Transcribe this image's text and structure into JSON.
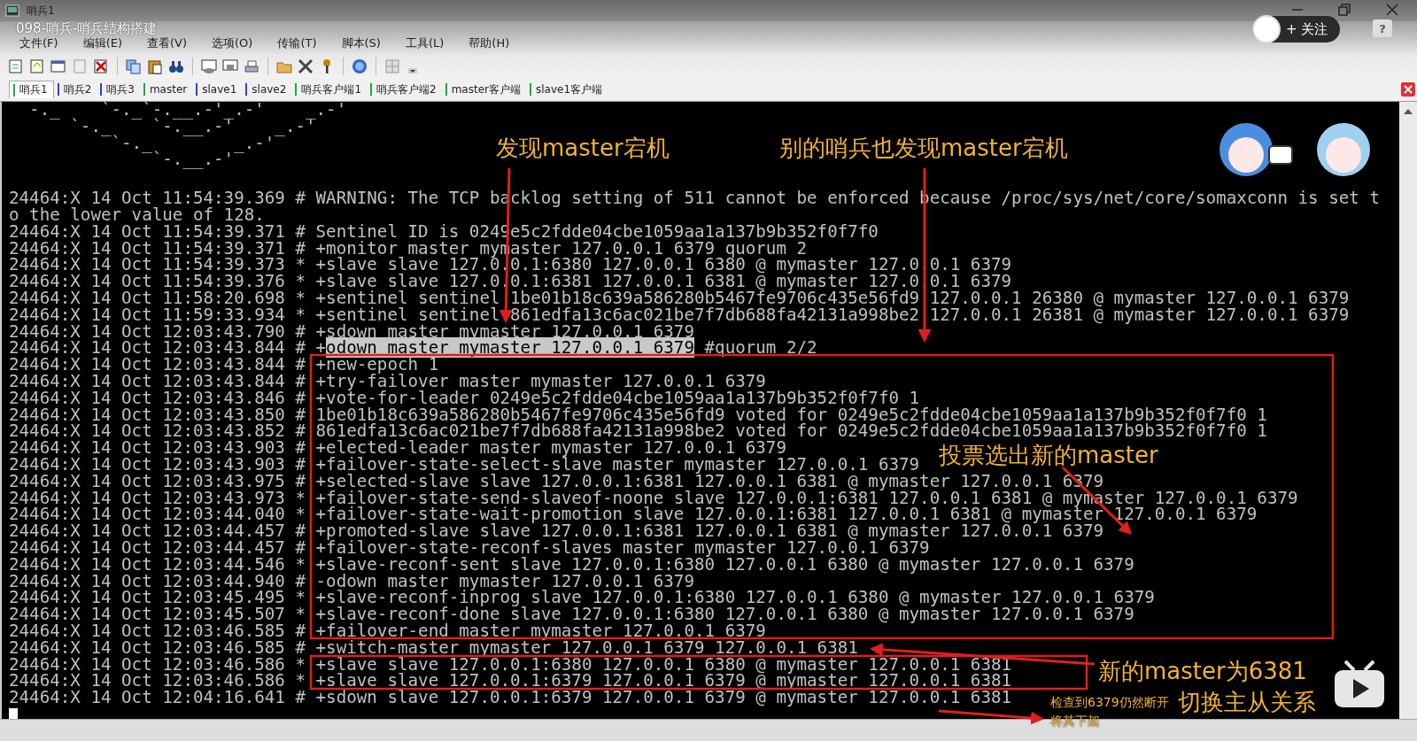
{
  "window": {
    "title": "哨兵1",
    "video_title": "098-哨兵-哨兵结构搭建"
  },
  "menu": [
    "文件(F)",
    "编辑(E)",
    "查看(V)",
    "选项(O)",
    "传输(T)",
    "脚本(S)",
    "工具(L)",
    "帮助(H)"
  ],
  "video_overlay": {
    "follow_button": "+ 关注",
    "help": "?"
  },
  "tabs": [
    {
      "label": "哨兵1",
      "selected": true,
      "color": "#22a83a"
    },
    {
      "label": "哨兵2",
      "selected": false,
      "color": "#2a3fd0"
    },
    {
      "label": "哨兵3",
      "selected": false,
      "color": "#2a3fd0"
    },
    {
      "label": "master",
      "selected": false,
      "color": "#22a83a"
    },
    {
      "label": "slave1",
      "selected": false,
      "color": "#2a3fd0"
    },
    {
      "label": "slave2",
      "selected": false,
      "color": "#2a3fd0"
    },
    {
      "label": "哨兵客户端1",
      "selected": false,
      "color": "#22a83a"
    },
    {
      "label": "哨兵客户端2",
      "selected": false,
      "color": "#22a83a"
    },
    {
      "label": "master客户端",
      "selected": false,
      "color": "#22a83a"
    },
    {
      "label": "slave1客户端",
      "selected": false,
      "color": "#22a83a"
    }
  ],
  "terminal": {
    "ascii_art": [
      "  -._    `-._`-.__.-'_.-'    _.-'",
      "      `-._    `-.__.-'    _.-'",
      "          `-._        _.-'",
      "              `-.__.-'"
    ],
    "lines": [
      {
        "kind": "plain",
        "text": "24464:X 14 Oct 11:54:39.369 # WARNING: The TCP backlog setting of 511 cannot be enforced because /proc/sys/net/core/somaxconn is set t"
      },
      {
        "kind": "plain",
        "text": "o the lower value of 128."
      },
      {
        "kind": "plain",
        "text": "24464:X 14 Oct 11:54:39.371 # Sentinel ID is 0249e5c2fdde04cbe1059aa1a137b9b352f0f7f0"
      },
      {
        "kind": "plain",
        "text": "24464:X 14 Oct 11:54:39.371 # +monitor master mymaster 127.0.0.1 6379 quorum 2"
      },
      {
        "kind": "plain",
        "text": "24464:X 14 Oct 11:54:39.373 * +slave slave 127.0.0.1:6380 127.0.0.1 6380 @ mymaster 127.0.0.1 6379"
      },
      {
        "kind": "plain",
        "text": "24464:X 14 Oct 11:54:39.376 * +slave slave 127.0.0.1:6381 127.0.0.1 6381 @ mymaster 127.0.0.1 6379"
      },
      {
        "kind": "plain",
        "text": "24464:X 14 Oct 11:58:20.698 * +sentinel sentinel 1be01b18c639a586280b5467fe9706c435e56fd9 127.0.0.1 26380 @ mymaster 127.0.0.1 6379"
      },
      {
        "kind": "plain",
        "text": "24464:X 14 Oct 11:59:33.934 * +sentinel sentinel 861edfa13c6ac021be7f7db688fa42131a998be2 127.0.0.1 26381 @ mymaster 127.0.0.1 6379"
      },
      {
        "kind": "plain",
        "text": "24464:X 14 Oct 12:03:43.790 # +sdown master mymaster 127.0.0.1 6379"
      },
      {
        "kind": "marked",
        "parts": [
          {
            "text": "24464:X 14 Oct 12:03:43.844 # +",
            "selected": false
          },
          {
            "text": "odown master mymaster 127.0.0.1 6379",
            "selected": true
          },
          {
            "text": " #quorum 2/2",
            "selected": false
          }
        ]
      },
      {
        "kind": "plain",
        "text": "24464:X 14 Oct 12:03:43.844 # +new-epoch 1"
      },
      {
        "kind": "plain",
        "text": "24464:X 14 Oct 12:03:43.844 # +try-failover master mymaster 127.0.0.1 6379"
      },
      {
        "kind": "plain",
        "text": "24464:X 14 Oct 12:03:43.846 # +vote-for-leader 0249e5c2fdde04cbe1059aa1a137b9b352f0f7f0 1"
      },
      {
        "kind": "plain",
        "text": "24464:X 14 Oct 12:03:43.850 # 1be01b18c639a586280b5467fe9706c435e56fd9 voted for 0249e5c2fdde04cbe1059aa1a137b9b352f0f7f0 1"
      },
      {
        "kind": "plain",
        "text": "24464:X 14 Oct 12:03:43.852 # 861edfa13c6ac021be7f7db688fa42131a998be2 voted for 0249e5c2fdde04cbe1059aa1a137b9b352f0f7f0 1"
      },
      {
        "kind": "plain",
        "text": "24464:X 14 Oct 12:03:43.903 # +elected-leader master mymaster 127.0.0.1 6379"
      },
      {
        "kind": "plain",
        "text": "24464:X 14 Oct 12:03:43.903 # +failover-state-select-slave master mymaster 127.0.0.1 6379"
      },
      {
        "kind": "plain",
        "text": "24464:X 14 Oct 12:03:43.975 # +selected-slave slave 127.0.0.1:6381 127.0.0.1 6381 @ mymaster 127.0.0.1 6379"
      },
      {
        "kind": "plain",
        "text": "24464:X 14 Oct 12:03:43.973 * +failover-state-send-slaveof-noone slave 127.0.0.1:6381 127.0.0.1 6381 @ mymaster 127.0.0.1 6379"
      },
      {
        "kind": "plain",
        "text": "24464:X 14 Oct 12:03:44.040 * +failover-state-wait-promotion slave 127.0.0.1:6381 127.0.0.1 6381 @ mymaster 127.0.0.1 6379"
      },
      {
        "kind": "plain",
        "text": "24464:X 14 Oct 12:03:44.457 # +promoted-slave slave 127.0.0.1:6381 127.0.0.1 6381 @ mymaster 127.0.0.1 6379"
      },
      {
        "kind": "plain",
        "text": "24464:X 14 Oct 12:03:44.457 # +failover-state-reconf-slaves master mymaster 127.0.0.1 6379"
      },
      {
        "kind": "plain",
        "text": "24464:X 14 Oct 12:03:44.546 * +slave-reconf-sent slave 127.0.0.1:6380 127.0.0.1 6380 @ mymaster 127.0.0.1 6379"
      },
      {
        "kind": "plain",
        "text": "24464:X 14 Oct 12:03:44.940 # -odown master mymaster 127.0.0.1 6379"
      },
      {
        "kind": "plain",
        "text": "24464:X 14 Oct 12:03:45.495 * +slave-reconf-inprog slave 127.0.0.1:6380 127.0.0.1 6380 @ mymaster 127.0.0.1 6379"
      },
      {
        "kind": "plain",
        "text": "24464:X 14 Oct 12:03:45.507 * +slave-reconf-done slave 127.0.0.1:6380 127.0.0.1 6380 @ mymaster 127.0.0.1 6379"
      },
      {
        "kind": "plain",
        "text": "24464:X 14 Oct 12:03:46.585 # +failover-end master mymaster 127.0.0.1 6379"
      },
      {
        "kind": "plain",
        "text": "24464:X 14 Oct 12:03:46.585 # +switch-master mymaster 127.0.0.1 6379 127.0.0.1 6381"
      },
      {
        "kind": "plain",
        "text": "24464:X 14 Oct 12:03:46.586 * +slave slave 127.0.0.1:6380 127.0.0.1 6380 @ mymaster 127.0.0.1 6381"
      },
      {
        "kind": "plain",
        "text": "24464:X 14 Oct 12:03:46.586 * +slave slave 127.0.0.1:6379 127.0.0.1 6379 @ mymaster 127.0.0.1 6381"
      },
      {
        "kind": "plain",
        "text": "24464:X 14 Oct 12:04:16.641 # +sdown slave 127.0.0.1:6379 127.0.0.1 6379 @ mymaster 127.0.0.1 6381"
      }
    ]
  },
  "annotations": [
    {
      "kind": "large",
      "text": "发现master宕机"
    },
    {
      "kind": "large",
      "text": "别的哨兵也发现master宕机"
    },
    {
      "kind": "large",
      "text": "投票选出新的master"
    },
    {
      "kind": "large",
      "text": "新的master为6381"
    },
    {
      "kind": "large",
      "text": "切换主从关系"
    },
    {
      "kind": "small",
      "text": "检查到6379仍然断开"
    },
    {
      "kind": "small",
      "text": "将其下架"
    }
  ]
}
